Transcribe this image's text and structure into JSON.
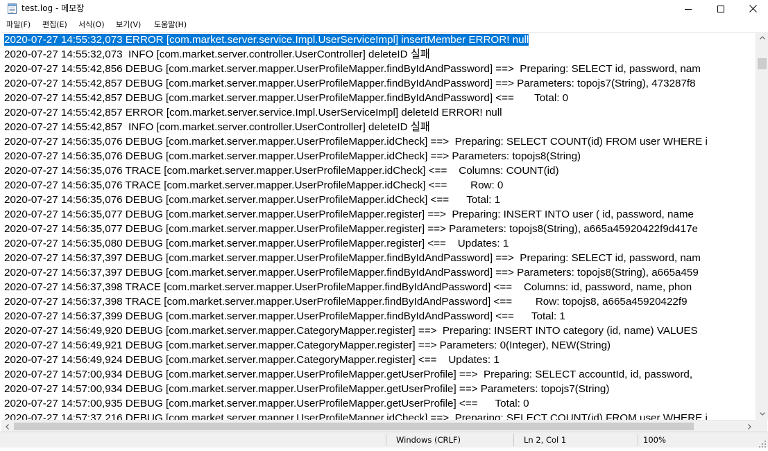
{
  "window": {
    "title": "test.log - 메모장",
    "minimize_glyph": "—",
    "maximize_glyph": "☐",
    "close_glyph": "✕",
    "icons": {
      "app": "notepad-icon"
    }
  },
  "menu": {
    "items": [
      {
        "label": "파일(F)"
      },
      {
        "label": "편집(E)"
      },
      {
        "label": "서식(O)"
      },
      {
        "label": "보기(V)"
      },
      {
        "label": "도움말(H)"
      }
    ]
  },
  "editor": {
    "selected_line": 0,
    "selection_color": "#0078d7",
    "lines": [
      "2020-07-27 14:55:32,073 ERROR [com.market.server.service.Impl.UserServiceImpl] insertMember ERROR! null",
      "2020-07-27 14:55:32,073  INFO [com.market.server.controller.UserController] deleteID 실패",
      "2020-07-27 14:55:42,856 DEBUG [com.market.server.mapper.UserProfileMapper.findByIdAndPassword] ==>  Preparing: SELECT id, password, nam",
      "2020-07-27 14:55:42,857 DEBUG [com.market.server.mapper.UserProfileMapper.findByIdAndPassword] ==> Parameters: topojs7(String), 473287f8",
      "2020-07-27 14:55:42,857 DEBUG [com.market.server.mapper.UserProfileMapper.findByIdAndPassword] <==       Total: 0",
      "2020-07-27 14:55:42,857 ERROR [com.market.server.service.Impl.UserServiceImpl] deleteId ERROR! null",
      "2020-07-27 14:55:42,857  INFO [com.market.server.controller.UserController] deleteID 실패",
      "2020-07-27 14:56:35,076 DEBUG [com.market.server.mapper.UserProfileMapper.idCheck] ==>  Preparing: SELECT COUNT(id) FROM user WHERE i",
      "2020-07-27 14:56:35,076 DEBUG [com.market.server.mapper.UserProfileMapper.idCheck] ==> Parameters: topojs8(String)",
      "2020-07-27 14:56:35,076 TRACE [com.market.server.mapper.UserProfileMapper.idCheck] <==    Columns: COUNT(id)",
      "2020-07-27 14:56:35,076 TRACE [com.market.server.mapper.UserProfileMapper.idCheck] <==        Row: 0",
      "2020-07-27 14:56:35,076 DEBUG [com.market.server.mapper.UserProfileMapper.idCheck] <==      Total: 1",
      "2020-07-27 14:56:35,077 DEBUG [com.market.server.mapper.UserProfileMapper.register] ==>  Preparing: INSERT INTO user ( id, password, name",
      "2020-07-27 14:56:35,077 DEBUG [com.market.server.mapper.UserProfileMapper.register] ==> Parameters: topojs8(String), a665a45920422f9d417e",
      "2020-07-27 14:56:35,080 DEBUG [com.market.server.mapper.UserProfileMapper.register] <==    Updates: 1",
      "2020-07-27 14:56:37,397 DEBUG [com.market.server.mapper.UserProfileMapper.findByIdAndPassword] ==>  Preparing: SELECT id, password, nam",
      "2020-07-27 14:56:37,397 DEBUG [com.market.server.mapper.UserProfileMapper.findByIdAndPassword] ==> Parameters: topojs8(String), a665a459",
      "2020-07-27 14:56:37,398 TRACE [com.market.server.mapper.UserProfileMapper.findByIdAndPassword] <==    Columns: id, password, name, phon",
      "2020-07-27 14:56:37,398 TRACE [com.market.server.mapper.UserProfileMapper.findByIdAndPassword] <==        Row: topojs8, a665a45920422f9",
      "2020-07-27 14:56:37,399 DEBUG [com.market.server.mapper.UserProfileMapper.findByIdAndPassword] <==      Total: 1",
      "2020-07-27 14:56:49,920 DEBUG [com.market.server.mapper.CategoryMapper.register] ==>  Preparing: INSERT INTO category (id, name) VALUES",
      "2020-07-27 14:56:49,921 DEBUG [com.market.server.mapper.CategoryMapper.register] ==> Parameters: 0(Integer), NEW(String)",
      "2020-07-27 14:56:49,924 DEBUG [com.market.server.mapper.CategoryMapper.register] <==    Updates: 1",
      "2020-07-27 14:57:00,934 DEBUG [com.market.server.mapper.UserProfileMapper.getUserProfile] ==>  Preparing: SELECT accountId, id, password,",
      "2020-07-27 14:57:00,934 DEBUG [com.market.server.mapper.UserProfileMapper.getUserProfile] ==> Parameters: topojs7(String)",
      "2020-07-27 14:57:00,935 DEBUG [com.market.server.mapper.UserProfileMapper.getUserProfile] <==      Total: 0",
      "2020-07-27 14:57:37,216 DEBUG [com.market.server.mapper.UserProfileMapper.idCheck] ==>  Preparing: SELECT COUNT(id) FROM user WHERE i"
    ]
  },
  "statusbar": {
    "line_ending": "Windows (CRLF)",
    "position": "Ln 2, Col 1",
    "zoom": "100%"
  }
}
